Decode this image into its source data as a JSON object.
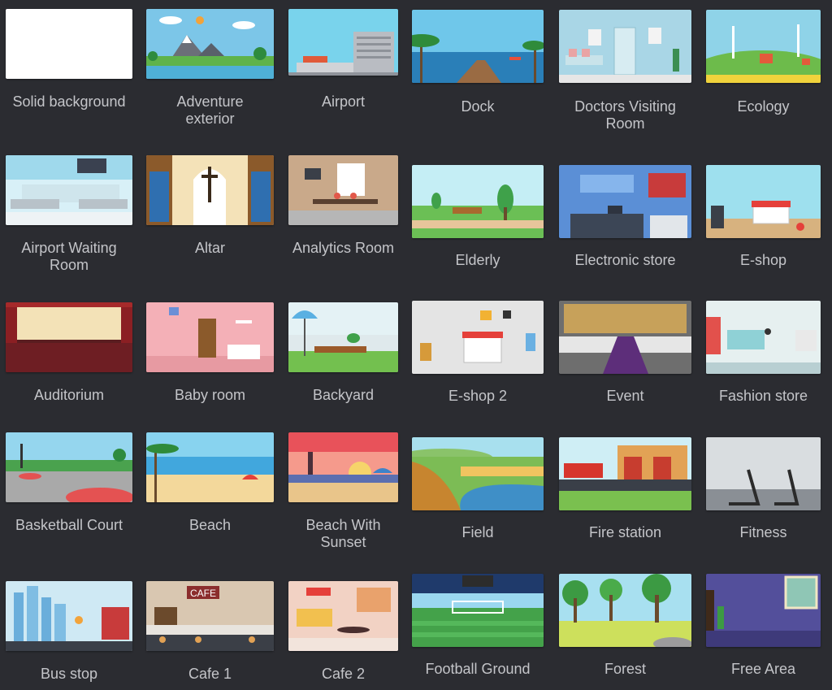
{
  "backgrounds": [
    {
      "label": "Solid background"
    },
    {
      "label": "Adventure\nexterior"
    },
    {
      "label": "Airport"
    },
    {
      "label": "Dock"
    },
    {
      "label": "Doctors Visiting\nRoom"
    },
    {
      "label": "Ecology"
    },
    {
      "label": "Airport Waiting\nRoom"
    },
    {
      "label": "Altar"
    },
    {
      "label": "Analytics Room"
    },
    {
      "label": "Elderly"
    },
    {
      "label": "Electronic store"
    },
    {
      "label": "E-shop"
    },
    {
      "label": "Auditorium"
    },
    {
      "label": "Baby room"
    },
    {
      "label": "Backyard"
    },
    {
      "label": "E-shop 2"
    },
    {
      "label": "Event"
    },
    {
      "label": "Fashion store"
    },
    {
      "label": "Basketball Court"
    },
    {
      "label": "Beach"
    },
    {
      "label": "Beach With\nSunset"
    },
    {
      "label": "Field"
    },
    {
      "label": "Fire station"
    },
    {
      "label": "Fitness"
    },
    {
      "label": "Bus stop"
    },
    {
      "label": "Cafe 1"
    },
    {
      "label": "Cafe 2"
    },
    {
      "label": "Football Ground"
    },
    {
      "label": "Forest"
    },
    {
      "label": "Free Area"
    }
  ],
  "thumbnail_texts": {
    "cafe_sign": "CAFE"
  }
}
